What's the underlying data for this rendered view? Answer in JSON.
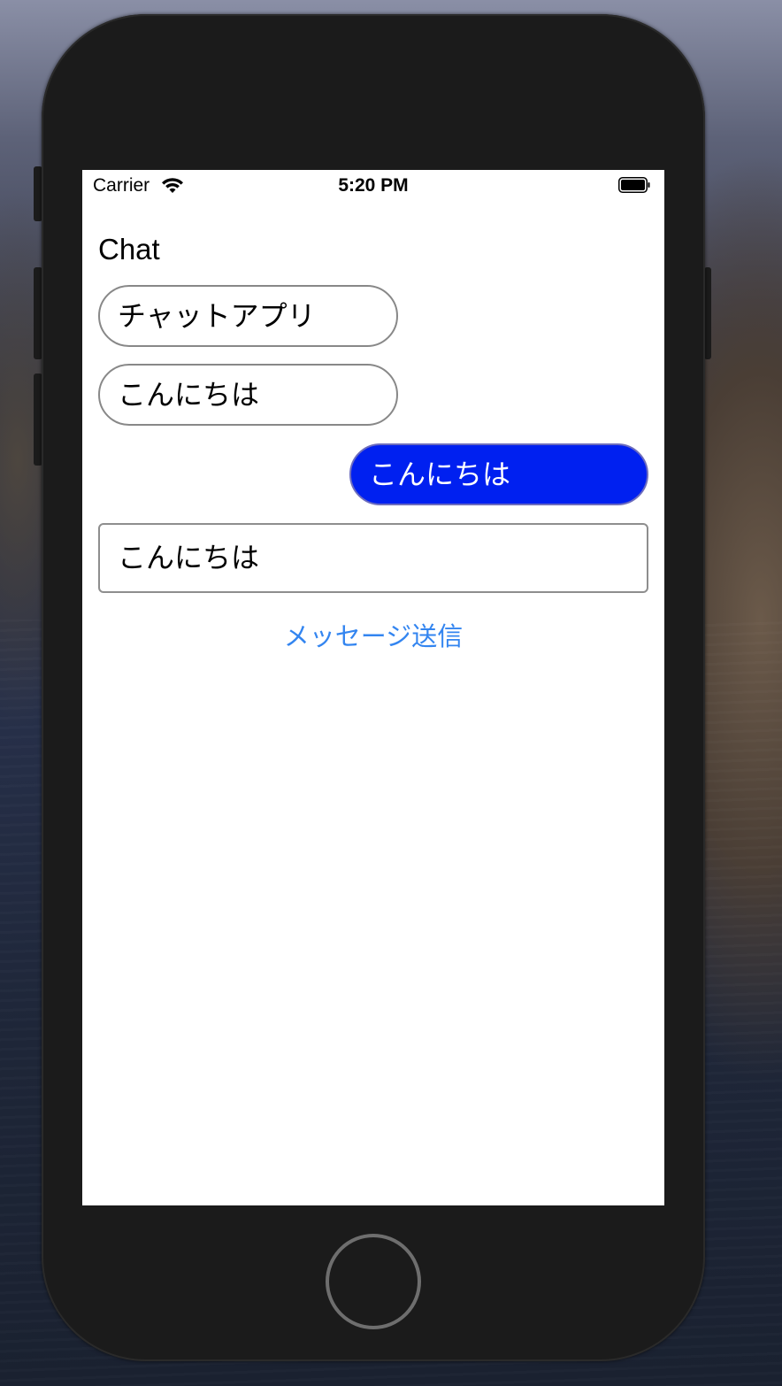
{
  "status_bar": {
    "carrier": "Carrier",
    "time": "5:20 PM"
  },
  "chat": {
    "title": "Chat",
    "messages": [
      {
        "text": "チャットアプリ",
        "direction": "received"
      },
      {
        "text": "こんにちは",
        "direction": "received"
      },
      {
        "text": "こんにちは",
        "direction": "sent"
      }
    ]
  },
  "composer": {
    "input_value": "こんにちは",
    "send_label": "メッセージ送信"
  },
  "colors": {
    "sent_bubble": "#0020f0",
    "link": "#3385f0",
    "received_border": "#888888"
  },
  "icons": [
    "wifi-icon",
    "battery-icon",
    "home-button"
  ]
}
